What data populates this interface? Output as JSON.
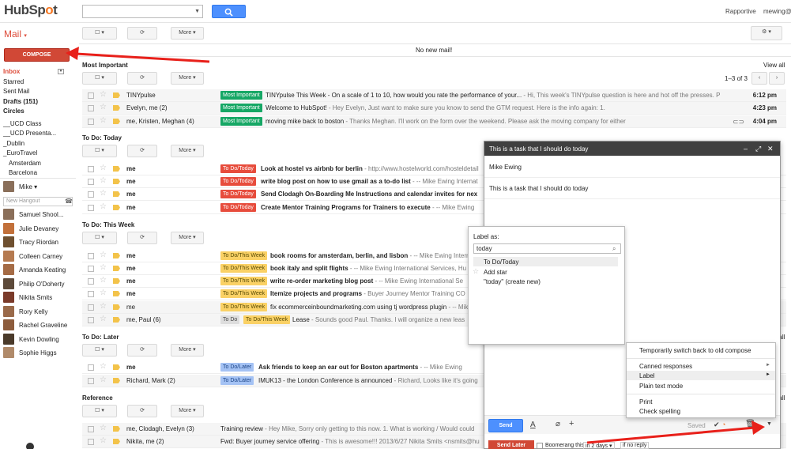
{
  "app": {
    "logo_pre": "HubSp",
    "logo_o": "o",
    "logo_post": "t",
    "user": "mewing@",
    "rapportive": "Rapportive"
  },
  "colors": {
    "accent": "#dd4b39",
    "compose": "#d14836",
    "blue": "#4d90fe",
    "green_label": "#16a765",
    "red_label": "#e74c3c",
    "yellow_label": "#fad165",
    "blue_label": "#a4c2f4"
  },
  "toolbar": {
    "more": "More",
    "no_new_mail": "No new mail!",
    "settings_icon": "gear-icon"
  },
  "nav": {
    "mail": "Mail",
    "compose": "COMPOSE",
    "items": [
      "Inbox",
      "Starred",
      "Sent Mail",
      "Drafts (151)",
      "Circles",
      "__UCD Class",
      "__UCD Presenta...",
      "_Dublin",
      "_EuroTravel",
      "Amsterdam",
      "Barcelona"
    ],
    "me": "Mike",
    "hangout_placeholder": "New Hangout",
    "contacts": [
      "Samuel Shool...",
      "Julie Devaney",
      "Tracy Riordan",
      "Colleen Carney",
      "Amanda Keating",
      "Philip O'Doherty",
      "Nikita Smits",
      "Rory Kelly",
      "Rachel Graveline",
      "Kevin Dowling",
      "Sophie Higgs"
    ]
  },
  "sections": {
    "important": {
      "title": "Most Important",
      "view_all": "View all",
      "count": "1–3 of 3"
    },
    "today": {
      "title": "To Do: Today"
    },
    "week": {
      "title": "To Do: This Week"
    },
    "later": {
      "title": "To Do: Later",
      "view_all": "View all"
    },
    "reference": {
      "title": "Reference",
      "view_all": "View all"
    }
  },
  "rows": {
    "important": [
      {
        "sender": "TINYpulse",
        "label": "Most Important",
        "subject": "TINYpulse This Week - On a scale of 1 to 10, how would you rate the performance of your...",
        "snippet": " - Hi, This week's TINYpulse question is here and hot off the presses. P",
        "time": "6:12 pm"
      },
      {
        "sender": "Evelyn, me (2)",
        "label": "Most Important",
        "subject": "Welcome to HubSpot!",
        "snippet": " - Hey Evelyn, Just want to make sure you know to send the GTM request. Here is the info again: 1.",
        "time": "4:23 pm"
      },
      {
        "sender": "me, Kristen, Meghan (4)",
        "label": "Most Important",
        "subject": "moving mike back to boston",
        "snippet": " - Thanks Meghan. I'll work on the form over the weekend. Please ask the moving company for either",
        "time": "4:04 pm"
      }
    ],
    "today": [
      {
        "sender": "me",
        "label": "To Do/Today",
        "subject": "Look at hostel vs airbnb for berlin",
        "snippet": " - http://www.hostelworld.com/hosteldetail"
      },
      {
        "sender": "me",
        "label": "To Do/Today",
        "subject": "write blog post on how to use gmail as a to-do list",
        "snippet": " - -- Mike Ewing Internat"
      },
      {
        "sender": "me",
        "label": "To Do/Today",
        "subject": "Send Clodagh On-Boarding Me Instructions and calendar invites for nex",
        "snippet": ""
      },
      {
        "sender": "me",
        "label": "To Do/Today",
        "subject": "Create Mentor Training Programs for Trainers to execute",
        "snippet": " - -- Mike Ewing"
      }
    ],
    "week": [
      {
        "sender": "me",
        "label": "To Do/This Week",
        "subject": "book rooms for amsterdam, berlin, and lisbon",
        "snippet": " - -- Mike Ewing Internat"
      },
      {
        "sender": "me",
        "label": "To Do/This Week",
        "subject": "book italy and split flights",
        "snippet": " - -- Mike Ewing International Services, Hu"
      },
      {
        "sender": "me",
        "label": "To Do/This Week",
        "subject": "write re-order marketing blog post",
        "snippet": " - -- Mike Ewing International Se"
      },
      {
        "sender": "me",
        "label": "To Do/This Week",
        "subject": "Itemize projects and programs",
        "snippet": " - Buyer Journey Mentor Training CO"
      },
      {
        "sender": "me",
        "label": "To Do/This Week",
        "subject": "fix ecommerceinboundmarketing.com using tj wordpress plugin",
        "snippet": " - -- Mike Ewing",
        "plain": true
      },
      {
        "sender": "me, Paul (6)",
        "label0": "To Do",
        "label": "To Do/This Week",
        "subject": "Lease",
        "snippet": " - Sounds good Paul. Thanks. I will organize a new leas",
        "plain": true
      }
    ],
    "later": [
      {
        "sender": "me",
        "label": "To Do/Later",
        "subject": "Ask friends to keep an ear out for Boston apartments",
        "snippet": " - -- Mike Ewing"
      },
      {
        "sender": "Richard, Mark (2)",
        "label": "To Do/Later",
        "subject": "IMUK13 - the London Conference is announced",
        "snippet": " - Richard, Looks like it's going",
        "plain": true
      }
    ],
    "reference": [
      {
        "sender": "me, Clodagh, Evelyn (3)",
        "subject": "Training review",
        "snippet": " - Hey Mike, Sorry only getting to this now. 1. What is working / Would could"
      },
      {
        "sender": "Nikita, me (2)",
        "subject": "Fwd: Buyer journey service offering",
        "snippet": " - This is awesome!!! 2013/6/27 Nikita Smits <nsmits@hu"
      }
    ]
  },
  "compose": {
    "title": "This is a task that I should do today",
    "to": "Mike Ewing",
    "subject": "This is a task that I should do today",
    "send": "Send",
    "saved": "Saved",
    "send_later": "Send Later",
    "boomerang": "Boomerang this",
    "boomerang_when": "in 2 days",
    "boomerang_cond": "if no reply"
  },
  "label_popup": {
    "title": "Label as:",
    "input": "today",
    "options": [
      "To Do/Today",
      "Add star",
      "\"today\" (create new)"
    ]
  },
  "more_menu": {
    "items": [
      "Temporarily switch back to old compose",
      "Canned responses",
      "Label",
      "Plain text mode",
      "Print",
      "Check spelling"
    ]
  }
}
